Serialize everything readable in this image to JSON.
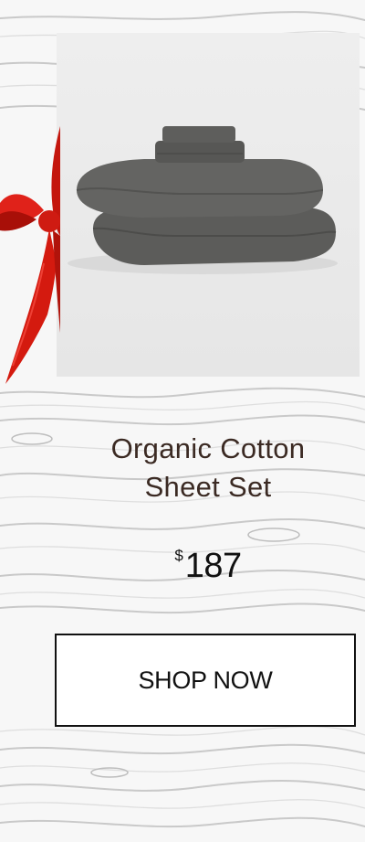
{
  "product": {
    "title_line1": "Organic Cotton",
    "title_line2": "Sheet Set",
    "currency": "$",
    "price": "187",
    "image_icon": "pillow-stack-image"
  },
  "cta": {
    "label": "SHOP NOW"
  },
  "decoration": {
    "ribbon": "red-bow-icon",
    "background": "white-wood-texture"
  },
  "colors": {
    "title": "#3b2a23",
    "ribbon": "#d41a0f",
    "pillow": "#5a5a58",
    "button_border": "#111111"
  }
}
